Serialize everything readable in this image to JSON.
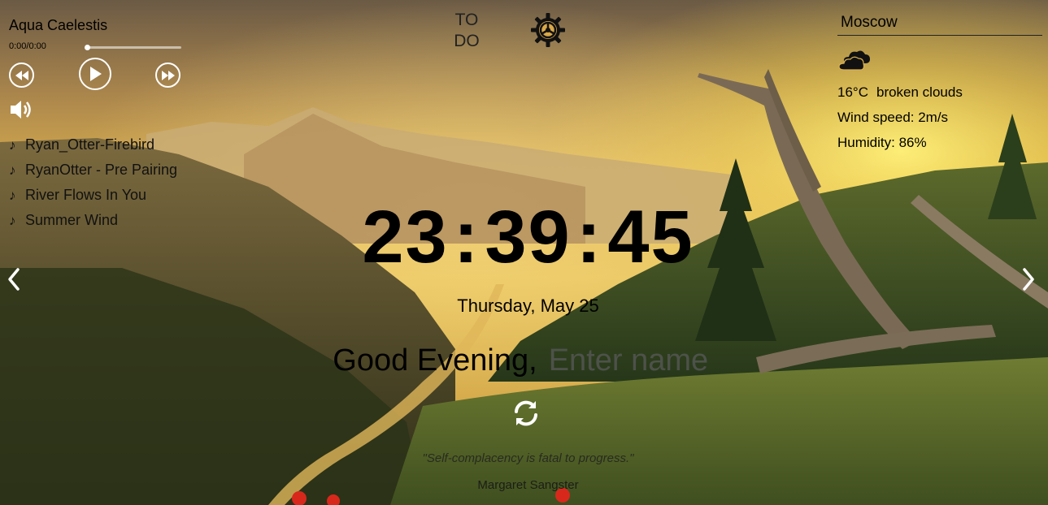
{
  "player": {
    "track_title": "Aqua Caelestis",
    "time": "0:00/0:00",
    "progress": 0,
    "playlist": [
      "Ryan_Otter-Firebird",
      "RyanOtter - Pre Pairing",
      "River Flows In You",
      "Summer Wind"
    ],
    "icons": {
      "prev": "rewind-icon",
      "play": "play-icon",
      "next": "fast-forward-icon",
      "volume": "volume-icon",
      "track": "music-note-icon"
    }
  },
  "todo": {
    "label_line1": "TO",
    "label_line2": "DO"
  },
  "settings": {
    "icon": "gear-icon"
  },
  "weather": {
    "city": "Moscow",
    "icon": "broken-clouds-icon",
    "temperature": "16°C",
    "description": "broken clouds",
    "wind": "Wind speed: 2m/s",
    "humidity": "Humidity: 86%"
  },
  "clock": {
    "hours": "23",
    "minutes": "39",
    "seconds": "45",
    "separator": ":"
  },
  "date": "Thursday, May 25",
  "greeting": {
    "text": "Good Evening,",
    "name_placeholder": "Enter name"
  },
  "quote": {
    "text": "\"Self-complacency is fatal to progress.\"",
    "author": "Margaret Sangster",
    "refresh_icon": "refresh-icon"
  },
  "navigation": {
    "prev_icon": "chevron-left-icon",
    "next_icon": "chevron-right-icon"
  }
}
